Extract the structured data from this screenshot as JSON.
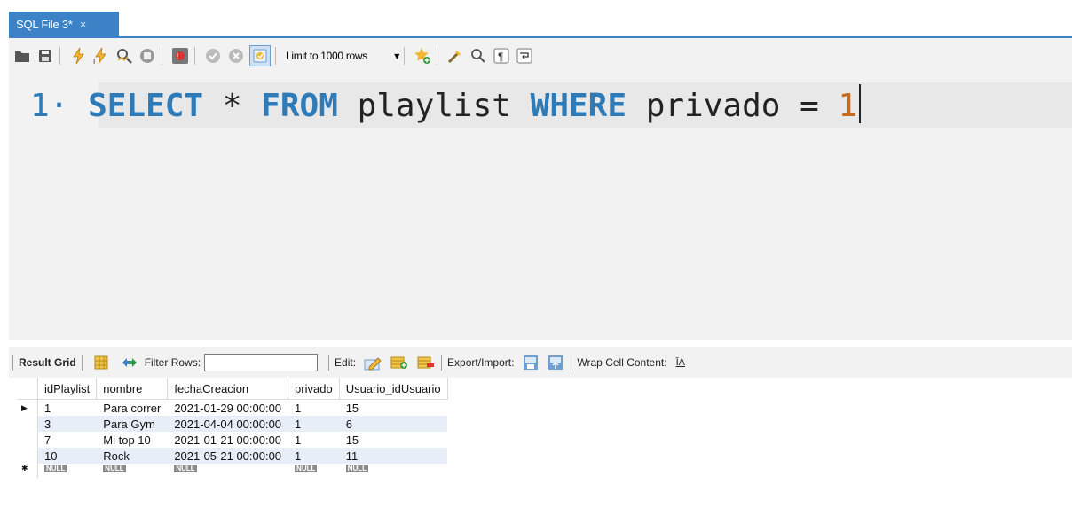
{
  "tab": {
    "title": "SQL File 3*",
    "close": "×"
  },
  "toolbar": {
    "limit_label": "Limit to 1000 rows",
    "limit_arrow": "▾"
  },
  "editor": {
    "line_number": "1",
    "bullet": "·",
    "tokens": {
      "select": "SELECT",
      "star": "*",
      "from": "FROM",
      "table": "playlist",
      "where": "WHERE",
      "column": "privado",
      "op": "=",
      "value": "1"
    }
  },
  "result_toolbar": {
    "result_grid": "Result Grid",
    "filter_rows": "Filter Rows:",
    "edit": "Edit:",
    "export_import": "Export/Import:",
    "wrap_cell": "Wrap Cell Content:",
    "wrap_icon": "ĪA"
  },
  "grid": {
    "columns": [
      "idPlaylist",
      "nombre",
      "fechaCreacion",
      "privado",
      "Usuario_idUsuario"
    ],
    "rows": [
      [
        "1",
        "Para correr",
        "2021-01-29 00:00:00",
        "1",
        "15"
      ],
      [
        "3",
        "Para Gym",
        "2021-04-04 00:00:00",
        "1",
        "6"
      ],
      [
        "7",
        "Mi top 10",
        "2021-01-21 00:00:00",
        "1",
        "15"
      ],
      [
        "10",
        "Rock",
        "2021-05-21 00:00:00",
        "1",
        "11"
      ]
    ],
    "null_label": "NULL",
    "current_row_marker": "▶",
    "new_row_marker": "✱"
  },
  "colors": {
    "accent": "#3b83c6",
    "keyword": "#2f7bb7",
    "number": "#c8691c",
    "alt_row": "#e8eef7"
  }
}
